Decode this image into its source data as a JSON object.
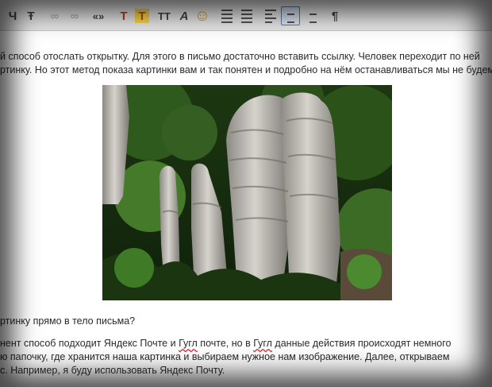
{
  "toolbar": {
    "buttons": [
      {
        "icon": "underline-icon",
        "glyph": "Ч"
      },
      {
        "icon": "strikethrough-icon",
        "glyph": "Ŧ"
      },
      {
        "icon": "link-icon",
        "glyph": "∞"
      },
      {
        "icon": "unlink-icon",
        "glyph": "∞"
      },
      {
        "icon": "quote-icon",
        "glyph": "«»"
      },
      {
        "icon": "text-color-icon",
        "glyph": "T"
      },
      {
        "icon": "highlight-icon",
        "glyph": "T"
      },
      {
        "icon": "font-size-icon",
        "glyph": "TT"
      },
      {
        "icon": "clear-format-icon",
        "glyph": "A"
      },
      {
        "icon": "emoji-icon",
        "glyph": "☺"
      },
      {
        "icon": "bullet-list-icon"
      },
      {
        "icon": "numbered-list-icon"
      },
      {
        "icon": "align-left-icon"
      },
      {
        "icon": "align-center-icon"
      },
      {
        "icon": "align-right-icon"
      },
      {
        "icon": "format-paint-icon",
        "glyph": "¶"
      }
    ],
    "selected": "align-center-icon"
  },
  "body": {
    "line1": "й способ отослать открытку. Для этого в письмо достаточно вставить ссылку. Человек переходит по ней",
    "line2": "ртинку. Но этот метод показа картинки вам и так понятен и подробно на нём останавливаться мы не будем.",
    "question": "ртинку прямо в тело письма?",
    "p3_a": "нент способ подходит Яндекс Почте и ",
    "p3_gugl1": "Гугл",
    "p3_b": " почте, но в ",
    "p3_gugl2": "Гугл",
    "p3_c": " данные действия происходят немного",
    "line4": "ю папочку, где хранится наша картинка и выбираем нужное нам изображение. Далее, открываем",
    "line5": "с. Например, я буду использовать Яндекс Почту."
  }
}
